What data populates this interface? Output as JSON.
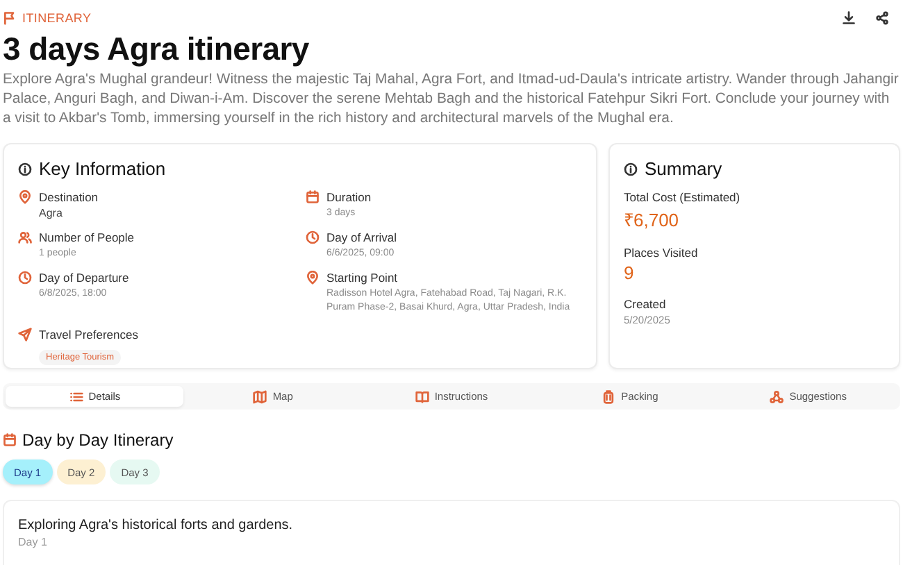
{
  "header": {
    "eyebrow": "ITINERARY",
    "title": "3 days Agra itinerary",
    "description": "Explore Agra's Mughal grandeur! Witness the majestic Taj Mahal, Agra Fort, and Itmad-ud-Daula's intricate artistry. Wander through Jahangir Palace, Anguri Bagh, and Diwan-i-Am. Discover the serene Mehtab Bagh and the historical Fatehpur Sikri Fort. Conclude your journey with a visit to Akbar's Tomb, immersing yourself in the rich history and architectural marvels of the Mughal era."
  },
  "key_information": {
    "title": "Key Information",
    "items": [
      {
        "kind": "pin",
        "label": "Destination",
        "value": "Agra",
        "emphasis": true
      },
      {
        "kind": "calendar",
        "label": "Duration",
        "value": "3 days",
        "emphasis": false
      },
      {
        "kind": "people",
        "label": "Number of People",
        "value": "1 people",
        "emphasis": false
      },
      {
        "kind": "clock",
        "label": "Day of Arrival",
        "value": "6/6/2025, 09:00",
        "emphasis": false
      },
      {
        "kind": "clock",
        "label": "Day of Departure",
        "value": "6/8/2025, 18:00",
        "emphasis": false
      },
      {
        "kind": "pin",
        "label": "Starting Point",
        "value": "Radisson Hotel Agra, Fatehabad Road, Taj Nagari, R.K. Puram Phase-2, Basai Khurd, Agra, Uttar Pradesh, India",
        "emphasis": false
      },
      {
        "kind": "send",
        "label": "Travel Preferences",
        "tags": [
          "Heritage Tourism"
        ]
      }
    ]
  },
  "summary": {
    "title": "Summary",
    "items": [
      {
        "label": "Total Cost (Estimated)",
        "value": "₹6,700",
        "kind": "highlight"
      },
      {
        "label": "Places Visited",
        "value": "9",
        "kind": "highlight"
      },
      {
        "label": "Created",
        "value": "5/20/2025",
        "kind": "plain"
      }
    ]
  },
  "tabs": [
    {
      "label": "Details",
      "selected": true
    },
    {
      "label": "Map",
      "selected": false
    },
    {
      "label": "Instructions",
      "selected": false
    },
    {
      "label": "Packing",
      "selected": false
    },
    {
      "label": "Suggestions",
      "selected": false
    }
  ],
  "itinerary": {
    "title": "Day by Day Itinerary",
    "days": [
      {
        "label": "Day 1",
        "color": "#a5f0fb",
        "selected": true
      },
      {
        "label": "Day 2",
        "color": "#fdf0d2",
        "selected": false
      },
      {
        "label": "Day 3",
        "color": "#e6f9f2",
        "selected": false
      }
    ],
    "day_card": {
      "title": "Exploring Agra's historical forts and gardens.",
      "subtitle": "Day 1"
    }
  }
}
